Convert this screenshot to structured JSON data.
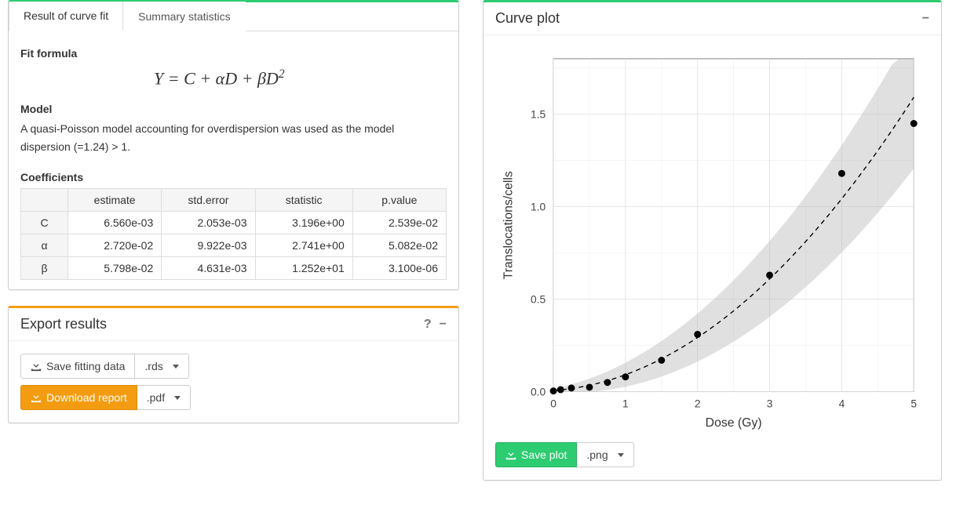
{
  "left_box": {
    "tabs": {
      "result": "Result of curve fit",
      "summary": "Summary statistics"
    },
    "fit_formula_label": "Fit formula",
    "formula_html": "Y = C + αD + βD²",
    "model_label": "Model",
    "model_desc": "A quasi-Poisson model accounting for overdispersion was used as the model dispersion (=1.24) > 1.",
    "coef_label": "Coefficients",
    "coef_headers": [
      "",
      "estimate",
      "std.error",
      "statistic",
      "p.value"
    ],
    "coef_rows": [
      {
        "name": "C",
        "estimate": "6.560e-03",
        "std_error": "2.053e-03",
        "statistic": "3.196e+00",
        "p_value": "2.539e-02"
      },
      {
        "name": "α",
        "estimate": "2.720e-02",
        "std_error": "9.922e-03",
        "statistic": "2.741e+00",
        "p_value": "5.082e-02"
      },
      {
        "name": "β",
        "estimate": "5.798e-02",
        "std_error": "4.631e-03",
        "statistic": "1.252e+01",
        "p_value": "3.100e-06"
      }
    ]
  },
  "export_box": {
    "title": "Export results",
    "save_fitting": "Save fitting data",
    "save_fitting_format": ".rds",
    "download_report": "Download report",
    "download_report_format": ".pdf"
  },
  "curve_box": {
    "title": "Curve plot",
    "save_plot": "Save plot",
    "save_plot_format": ".png"
  },
  "chart_data": {
    "type": "scatter_with_curve",
    "xlabel": "Dose (Gy)",
    "ylabel": "Translocations/cells",
    "xlim": [
      0,
      5
    ],
    "ylim": [
      0,
      1.8
    ],
    "xticks": [
      0,
      1,
      2,
      3,
      4,
      5
    ],
    "yticks": [
      0.0,
      0.5,
      1.0,
      1.5
    ],
    "points": [
      {
        "x": 0.0,
        "y": 0.004
      },
      {
        "x": 0.1,
        "y": 0.011
      },
      {
        "x": 0.25,
        "y": 0.02
      },
      {
        "x": 0.5,
        "y": 0.024
      },
      {
        "x": 0.75,
        "y": 0.05
      },
      {
        "x": 1.0,
        "y": 0.08
      },
      {
        "x": 1.5,
        "y": 0.17
      },
      {
        "x": 2.0,
        "y": 0.31
      },
      {
        "x": 3.0,
        "y": 0.63
      },
      {
        "x": 4.0,
        "y": 1.18
      },
      {
        "x": 5.0,
        "y": 1.45
      }
    ],
    "curve": {
      "C": 0.00656,
      "alpha": 0.0272,
      "beta": 0.05798
    },
    "confidence_band": true
  }
}
